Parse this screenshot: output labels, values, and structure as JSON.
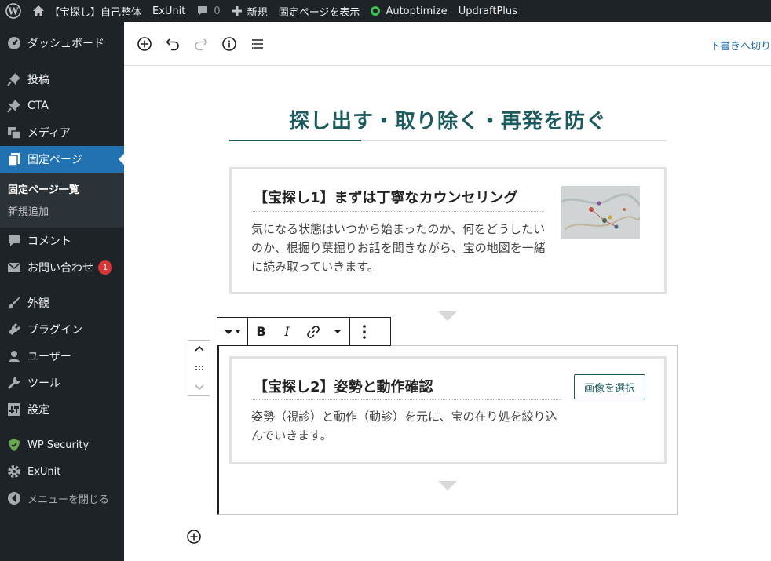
{
  "admin_bar": {
    "site_name": "【宝探し】自己整体",
    "theme_name": "ExUnit",
    "comment_count": "0",
    "new_label": "新規",
    "view_page_label": "固定ページを表示",
    "autoptimize_label": "Autoptimize",
    "updraft_label": "UpdraftPlus"
  },
  "sidebar": {
    "dashboard": "ダッシュボード",
    "posts": "投稿",
    "cta": "CTA",
    "media": "メディア",
    "pages": "固定ページ",
    "pages_all": "固定ページ一覧",
    "pages_new": "新規追加",
    "comments": "コメント",
    "contact": "お問い合わせ",
    "contact_badge": "1",
    "appearance": "外観",
    "plugins": "プラグイン",
    "users": "ユーザー",
    "tools": "ツール",
    "settings": "設定",
    "wp_security": "WP Security",
    "exunit": "ExUnit",
    "collapse": "メニューを閉じる"
  },
  "header": {
    "save_draft": "下書きへ切り"
  },
  "content": {
    "heading": "探し出す・取り除く・再発を防ぐ",
    "card1": {
      "title": "【宝探し1】まずは丁寧なカウンセリング",
      "text": "気になる状態はいつから始まったのか、何をどうしたいのか、根掘り葉掘りお話を聞きながら、宝の地図を一緒に読み取っていきます。"
    },
    "card2": {
      "title": "【宝探し2】姿勢と動作確認",
      "text": "姿勢（視診）と動作（動診）を元に、宝の在り処を絞り込んでいきます。",
      "button": "画像を選択"
    }
  },
  "block_toolbar": {
    "bold": "B",
    "italic": "I"
  },
  "colors": {
    "admin_dark": "#1d2327",
    "accent_blue": "#2271b1",
    "heading_teal": "#1c5a5d",
    "badge_red": "#d63638"
  }
}
